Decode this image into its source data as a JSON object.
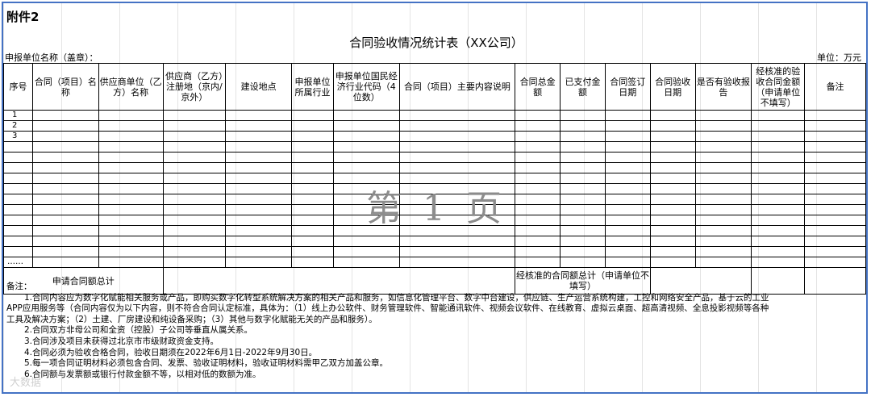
{
  "header": {
    "attachment": "附件2",
    "title": "合同验收情况统计表（XX公司）",
    "applicant": "申报单位名称（盖章）：",
    "unit": "单位：万元"
  },
  "table": {
    "columns": [
      "序号",
      "合同（项目）名称",
      "供应商单位（乙方）名称",
      "供应商（乙方）注册地（京内/京外）",
      "建设地点",
      "申报单位所属行业",
      "申报单位国民经济行业代码（4位数）",
      "合同（项目）主要内容说明",
      "合同总金额",
      "已支付金额",
      "合同签订日期",
      "合同验收日期",
      "是否有验收报告",
      "经核准的验收合同金额（申请单位不填写）",
      "备注"
    ],
    "rows": [
      "1",
      "2",
      "3",
      "",
      "",
      "",
      "",
      "",
      "",
      "",
      "",
      "",
      "",
      "",
      "……"
    ],
    "total_label": "申请合同额总计",
    "approved_total_label": "经核准的合同额总计（申请单位不填写）"
  },
  "watermark": "第 1 页",
  "notes": {
    "heading": "备注：",
    "items": [
      "1.合同内容应为数字化赋能相关服务或产品，即购买数字化转型系统解决方案的相关产品和服务，如信息化管理平台、数字中台建设，供应链、生产运营系统构建，工控和网络安全产品，基于云的工业",
      "APP应用服务等（合同内容仅为以下内容，则不符合合同认定标准，具体为：（1）线上办公软件、财务管理软件、智能通讯软件、视频会议软件、在线教育、虚拟云桌面、超高清视频、全息投影视频等各种",
      "工具及解决方案；（2）土建、厂房建设和纯设备采购；（3）其他与数字化赋能无关的产品和服务）。",
      "2.合同双方非母公司和全资（控股）子公司等垂直从属关系。",
      "3.合同涉及项目未获得过北京市市级财政资金支持。",
      "4.合同必须为验收合格合同，验收日期须在2022年6月1日-2022年9月30日。",
      "5.每一项合同证明材料必须包含合同、发票、验收证明材料，验收证明材料需甲乙双方加盖公章。",
      "6.合同额与发票额或银行付款金额不等，以相对低的数额为准。"
    ]
  },
  "footer_mark": "大数据"
}
